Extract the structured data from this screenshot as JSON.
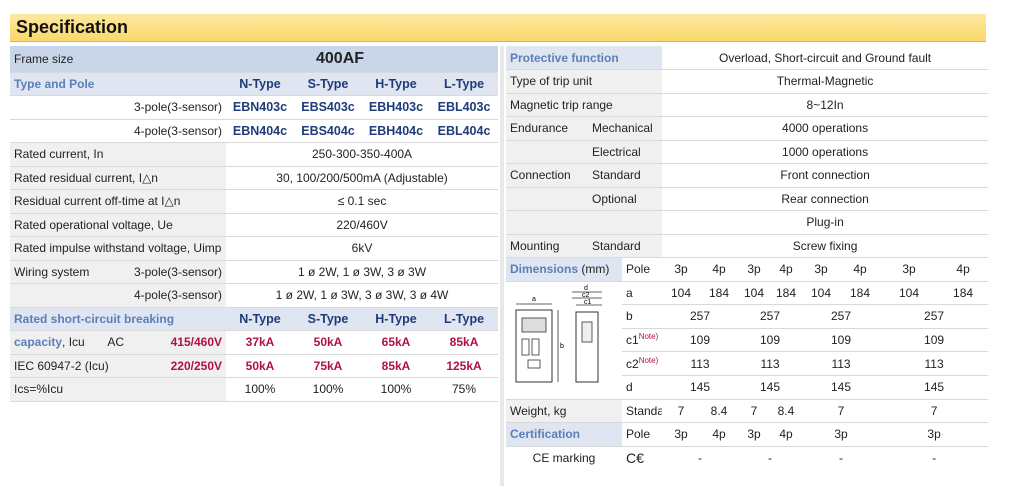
{
  "title": "Specification",
  "left": {
    "frame_label": "Frame size",
    "frame_value": "400AF",
    "type_pole_label": "Type and Pole",
    "types": [
      "N-Type",
      "S-Type",
      "H-Type",
      "L-Type"
    ],
    "pole3_label": "3-pole(3-sensor)",
    "pole3_models": [
      "EBN403c",
      "EBS403c",
      "EBH403c",
      "EBL403c"
    ],
    "pole4_label": "4-pole(3-sensor)",
    "pole4_models": [
      "EBN404c",
      "EBS404c",
      "EBH404c",
      "EBL404c"
    ],
    "rated_current_label": "Rated current, In",
    "rated_current_value": "250-300-350-400A",
    "residual_current_label": "Rated residual current, I△n",
    "residual_current_value": "30, 100/200/500mA (Adjustable)",
    "offtime_label": "Residual current off-time at I△n",
    "offtime_value": "≤ 0.1 sec",
    "voltage_label": "Rated operational voltage, Ue",
    "voltage_value": "220/460V",
    "impulse_label": "Rated impulse withstand voltage, Uimp",
    "impulse_value": "6kV",
    "wiring_label": "Wiring system",
    "wiring3_label": "3-pole(3-sensor)",
    "wiring3_value": "1 ø 2W, 1 ø 3W, 3 ø 3W",
    "wiring4_label": "4-pole(3-sensor)",
    "wiring4_value": "1 ø 2W, 1 ø 3W, 3 ø 3W, 3 ø 4W",
    "breaking_label": "Rated short-circuit breaking",
    "capacity_label": "capacity",
    "capacity_unit": ", Icu",
    "ac_label": "AC",
    "ac_voltage": "415/460V",
    "ac_values": [
      "37kA",
      "50kA",
      "65kA",
      "85kA"
    ],
    "iec_label": "IEC 60947-2 (Icu)",
    "iec_voltage": "220/250V",
    "iec_values": [
      "50kA",
      "75kA",
      "85kA",
      "125kA"
    ],
    "ics_label": "Ics=%Icu",
    "ics_values": [
      "100%",
      "100%",
      "100%",
      "75%"
    ]
  },
  "right": {
    "protective_label": "Protective function",
    "protective_value": "Overload, Short-circuit and Ground fault",
    "trip_type_label": "Type of trip unit",
    "trip_type_value": "Thermal-Magnetic",
    "magnetic_label": "Magnetic trip range",
    "magnetic_value": "8~12In",
    "endurance_label": "Endurance",
    "mechanical_label": "Mechanical",
    "mechanical_value": "4000 operations",
    "electrical_label": "Electrical",
    "electrical_value": "1000 operations",
    "connection_label": "Connection",
    "standard_label": "Standard",
    "front_value": "Front connection",
    "optional_label": "Optional",
    "rear_value": "Rear connection",
    "plugin_value": "Plug-in",
    "mounting_label": "Mounting",
    "mounting_std_label": "Standard",
    "mounting_value": "Screw fixing",
    "dimensions_label": "Dimensions",
    "dimensions_unit": "(mm)",
    "pole_label": "Pole",
    "poles": [
      "3p",
      "4p",
      "3p",
      "4p",
      "3p",
      "4p",
      "3p",
      "4p"
    ],
    "dim_a_label": "a",
    "dim_a": [
      "104",
      "184",
      "104",
      "184",
      "104",
      "184",
      "104",
      "184"
    ],
    "dim_b_label": "b",
    "dim_b": [
      "257",
      "257",
      "257",
      "257"
    ],
    "dim_c1_label": "c1",
    "dim_c1": [
      "109",
      "109",
      "109",
      "109"
    ],
    "dim_c2_label": "c2",
    "dim_c2": [
      "113",
      "113",
      "113",
      "113"
    ],
    "dim_d_label": "d",
    "dim_d": [
      "145",
      "145",
      "145",
      "145"
    ],
    "note_label": "Note)",
    "weight_label": "Weight, kg",
    "weight_std_label": "Standard",
    "weight_values": [
      "7",
      "8.4",
      "7",
      "8.4",
      "7",
      "7"
    ],
    "cert_label": "Certification",
    "cert_pole_label": "Pole",
    "cert_poles": [
      "3p",
      "4p",
      "3p",
      "4p",
      "3p",
      "3p"
    ],
    "ce_label": "CE marking",
    "ce_symbol": "C€",
    "ce_values": [
      "-",
      "-",
      "-",
      "-"
    ],
    "diagram_labels": [
      "a",
      "b",
      "d",
      "c2",
      "c1"
    ]
  }
}
